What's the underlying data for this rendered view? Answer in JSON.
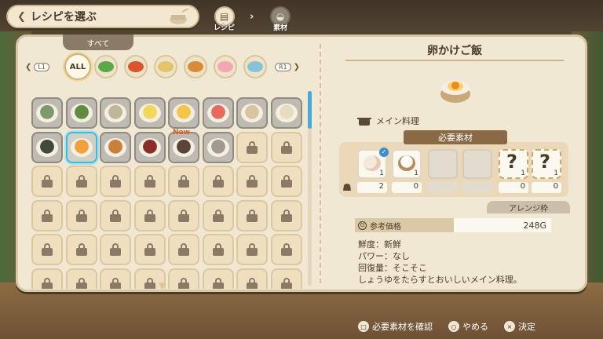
{
  "header": {
    "title": "レシピを選ぶ",
    "breadcrumbs": [
      {
        "label": "レシピ",
        "icon": "recipe-book-icon",
        "active": true
      },
      {
        "label": "素材",
        "icon": "ingredient-basket-icon",
        "active": false
      }
    ]
  },
  "category_bar": {
    "current_label": "すべて",
    "left_key": "L1",
    "right_key": "R1",
    "tabs": [
      {
        "id": "all",
        "label": "ALL",
        "active": true
      },
      {
        "id": "salad",
        "icon": "salad-icon",
        "color": "#5aa84a"
      },
      {
        "id": "soup",
        "icon": "tomato-soup-icon",
        "color": "#d9552e"
      },
      {
        "id": "side",
        "icon": "side-dish-icon",
        "color": "#e2c56a"
      },
      {
        "id": "fried",
        "icon": "fried-food-icon",
        "color": "#d98a3a"
      },
      {
        "id": "cake",
        "icon": "cake-icon",
        "color": "#f2a7b4"
      },
      {
        "id": "drink",
        "icon": "drink-icon",
        "color": "#86c3d9"
      }
    ]
  },
  "recipe_grid": {
    "rows": [
      [
        {
          "state": "food",
          "icon": "green-stirfry-icon",
          "color": "#7f9a6a"
        },
        {
          "state": "food",
          "icon": "herb-soup-icon",
          "color": "#5f8c3f"
        },
        {
          "state": "food",
          "icon": "noodle-plate-icon",
          "color": "#bfb79a"
        },
        {
          "state": "food",
          "icon": "scrambled-egg-icon",
          "color": "#f2d85a"
        },
        {
          "state": "food",
          "icon": "fried-egg-icon",
          "color": "#f7c44a"
        },
        {
          "state": "food",
          "icon": "sashimi-icon",
          "color": "#e86a5e"
        },
        {
          "state": "food",
          "icon": "rice-cake-icon",
          "color": "#d9c4a0"
        },
        {
          "state": "food",
          "icon": "porridge-icon",
          "color": "#e8dcbf"
        }
      ],
      [
        {
          "state": "food",
          "icon": "onigiri-icon",
          "color": "#3f4a3a"
        },
        {
          "state": "selected",
          "icon": "tamago-kake-gohan-icon",
          "color": "#f2a13a"
        },
        {
          "state": "food",
          "icon": "grilled-fish-icon",
          "color": "#c9803a"
        },
        {
          "state": "food",
          "icon": "berry-cake-icon",
          "color": "#8a2e2a"
        },
        {
          "state": "food",
          "icon": "dark-dish-icon",
          "color": "#5a4638",
          "new_label": "New"
        },
        {
          "state": "food",
          "icon": "glass-drink-icon",
          "color": "#a09a92"
        },
        {
          "state": "locked"
        },
        {
          "state": "locked"
        }
      ],
      [
        {
          "state": "locked"
        },
        {
          "state": "locked"
        },
        {
          "state": "locked"
        },
        {
          "state": "locked"
        },
        {
          "state": "locked"
        },
        {
          "state": "locked"
        },
        {
          "state": "locked"
        },
        {
          "state": "locked"
        }
      ],
      [
        {
          "state": "locked"
        },
        {
          "state": "locked"
        },
        {
          "state": "locked"
        },
        {
          "state": "locked"
        },
        {
          "state": "locked"
        },
        {
          "state": "locked"
        },
        {
          "state": "locked"
        },
        {
          "state": "locked"
        }
      ],
      [
        {
          "state": "locked"
        },
        {
          "state": "locked"
        },
        {
          "state": "locked"
        },
        {
          "state": "locked"
        },
        {
          "state": "locked"
        },
        {
          "state": "locked"
        },
        {
          "state": "locked"
        },
        {
          "state": "locked"
        }
      ],
      [
        {
          "state": "locked"
        },
        {
          "state": "locked"
        },
        {
          "state": "locked"
        },
        {
          "state": "locked"
        },
        {
          "state": "locked"
        },
        {
          "state": "locked"
        },
        {
          "state": "locked"
        },
        {
          "state": "locked"
        }
      ]
    ]
  },
  "detail": {
    "name": "卵かけご飯",
    "category": "メイン料理",
    "required_label": "必要素材",
    "ingredients": [
      {
        "icon": "eggs-icon",
        "need": "1",
        "have": "2",
        "checked": true,
        "kind": "filled"
      },
      {
        "icon": "rice-bowl-icon",
        "need": "1",
        "have": "0",
        "checked": false,
        "kind": "filled"
      },
      {
        "kind": "empty"
      },
      {
        "kind": "empty"
      },
      {
        "kind": "unknown",
        "mark": "?",
        "need": "1",
        "have": "0"
      },
      {
        "kind": "unknown",
        "mark": "?",
        "need": "1",
        "have": "0"
      }
    ],
    "arrange_label": "アレンジ枠",
    "price_label": "参考価格",
    "price_value": "248G",
    "info_lines": [
      "鮮度：新鮮",
      "パワー：なし",
      "回復量：そこそこ",
      "しょうゆをたらすとおいしいメイン料理。"
    ]
  },
  "prompts": [
    {
      "button": "□",
      "label": "必要素材を確認"
    },
    {
      "button": "○",
      "label": "やめる"
    },
    {
      "button": "×",
      "label": "決定"
    }
  ],
  "colors": {
    "selection": "#48b7d6",
    "panel": "#f1e8d3",
    "accent_brown": "#8a6a44"
  }
}
